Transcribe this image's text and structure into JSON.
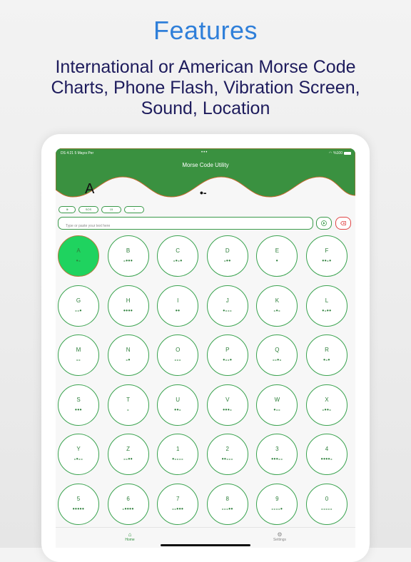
{
  "promo": {
    "title": "Features",
    "subtitle": "International or American Morse Code Charts, Phone Flash, Vibration Screen, Sound, Location"
  },
  "status_bar": {
    "time_date": "DS 4:21   5 Mayıs Per",
    "dots": "•••",
    "battery": "%100"
  },
  "app": {
    "title": "Morse Code Utility",
    "current_letter": "A",
    "current_code": "•-",
    "colors": {
      "header": "#3a9140",
      "accent": "#2d7f3a",
      "active_key": "#1fd35f",
      "clear": "#e04545"
    }
  },
  "controls": {
    "pills": [
      {
        "label": "",
        "icon": "target-icon"
      },
      {
        "label": "SOS"
      },
      {
        "label": "15"
      },
      {
        "label": "+"
      }
    ],
    "input_placeholder": "Type or paste your text here",
    "play_icon": "play-circle-icon",
    "clear_icon": "clear-icon"
  },
  "keys": [
    {
      "ch": "A",
      "code": "•-",
      "active": true
    },
    {
      "ch": "B",
      "code": "-•••"
    },
    {
      "ch": "C",
      "code": "-•-•"
    },
    {
      "ch": "D",
      "code": "-••"
    },
    {
      "ch": "E",
      "code": "•"
    },
    {
      "ch": "F",
      "code": "••-•"
    },
    {
      "ch": "G",
      "code": "--•"
    },
    {
      "ch": "H",
      "code": "••••"
    },
    {
      "ch": "I",
      "code": "••"
    },
    {
      "ch": "J",
      "code": "•---"
    },
    {
      "ch": "K",
      "code": "-•-"
    },
    {
      "ch": "L",
      "code": "•-••"
    },
    {
      "ch": "M",
      "code": "--"
    },
    {
      "ch": "N",
      "code": "-•"
    },
    {
      "ch": "O",
      "code": "---"
    },
    {
      "ch": "P",
      "code": "•--•"
    },
    {
      "ch": "Q",
      "code": "--•-"
    },
    {
      "ch": "R",
      "code": "•-•"
    },
    {
      "ch": "S",
      "code": "•••"
    },
    {
      "ch": "T",
      "code": "-"
    },
    {
      "ch": "U",
      "code": "••-"
    },
    {
      "ch": "V",
      "code": "•••-"
    },
    {
      "ch": "W",
      "code": "•--"
    },
    {
      "ch": "X",
      "code": "-••-"
    },
    {
      "ch": "Y",
      "code": "-•--"
    },
    {
      "ch": "Z",
      "code": "--••"
    },
    {
      "ch": "1",
      "code": "•----"
    },
    {
      "ch": "2",
      "code": "••---"
    },
    {
      "ch": "3",
      "code": "•••--"
    },
    {
      "ch": "4",
      "code": "••••-"
    },
    {
      "ch": "5",
      "code": "•••••"
    },
    {
      "ch": "6",
      "code": "-••••"
    },
    {
      "ch": "7",
      "code": "--•••"
    },
    {
      "ch": "8",
      "code": "---••"
    },
    {
      "ch": "9",
      "code": "----•"
    },
    {
      "ch": "0",
      "code": "-----"
    }
  ],
  "tabs": [
    {
      "label": "Home",
      "icon": "home-icon"
    },
    {
      "label": "Settings",
      "icon": "gear-icon"
    }
  ]
}
